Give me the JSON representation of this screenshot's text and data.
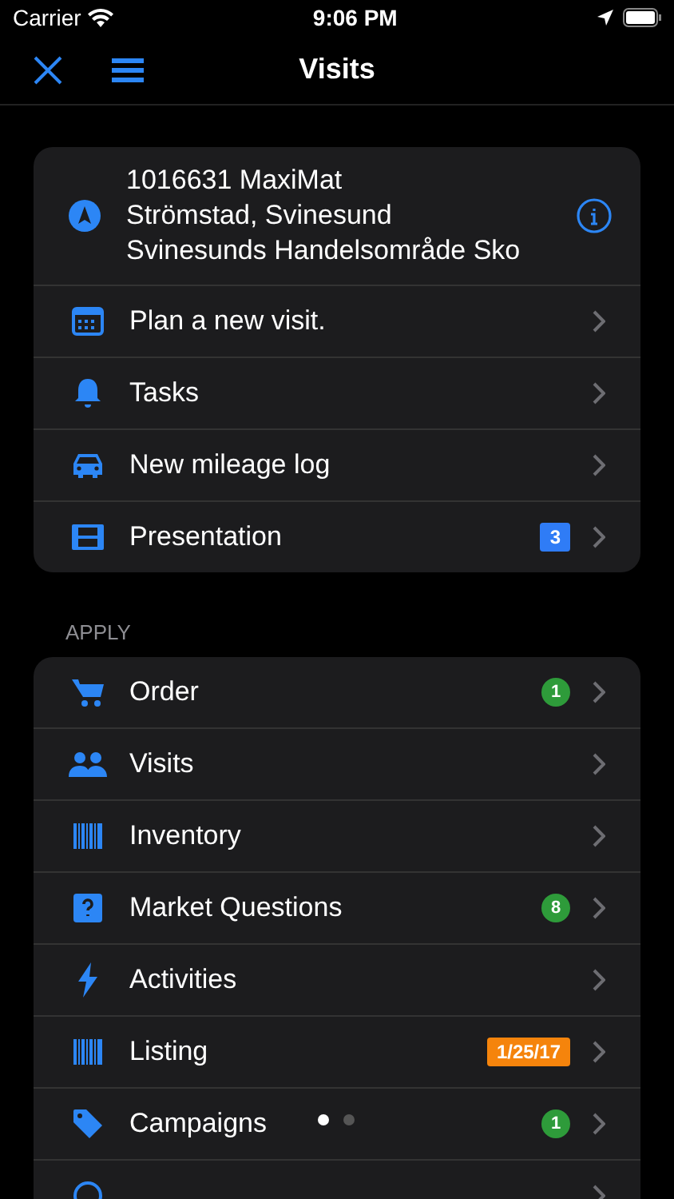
{
  "status_bar": {
    "carrier": "Carrier",
    "time": "9:06 PM"
  },
  "nav": {
    "title": "Visits"
  },
  "customer": {
    "lines": [
      "1016631 MaxiMat",
      "Strömstad, Svinesund",
      "Svinesunds Handelsområde Sko"
    ]
  },
  "actions": [
    {
      "kind": "calendar",
      "label": "Plan a new visit."
    },
    {
      "kind": "bell",
      "label": "Tasks"
    },
    {
      "kind": "car",
      "label": "New mileage log"
    },
    {
      "kind": "film",
      "label": "Presentation",
      "badge": {
        "text": "3",
        "kind": "square",
        "color": "#2f7cf6"
      }
    }
  ],
  "apply": {
    "header": "APPLY",
    "items": [
      {
        "kind": "cart",
        "label": "Order",
        "badge": {
          "text": "1",
          "kind": "round",
          "color": "#2e9b3a"
        }
      },
      {
        "kind": "people",
        "label": "Visits"
      },
      {
        "kind": "barcode",
        "label": "Inventory"
      },
      {
        "kind": "question",
        "label": "Market Questions",
        "badge": {
          "text": "8",
          "kind": "round",
          "color": "#2e9b3a"
        }
      },
      {
        "kind": "bolt",
        "label": "Activities"
      },
      {
        "kind": "barcode",
        "label": "Listing",
        "badge": {
          "text": "1/25/17",
          "kind": "square",
          "color": "#f5840c"
        }
      },
      {
        "kind": "tag",
        "label": "Campaigns",
        "badge": {
          "text": "1",
          "kind": "round",
          "color": "#2e9b3a"
        }
      },
      {
        "kind": "circle"
      }
    ]
  },
  "pages": [
    {
      "selected": true
    },
    {
      "selected": false
    }
  ]
}
